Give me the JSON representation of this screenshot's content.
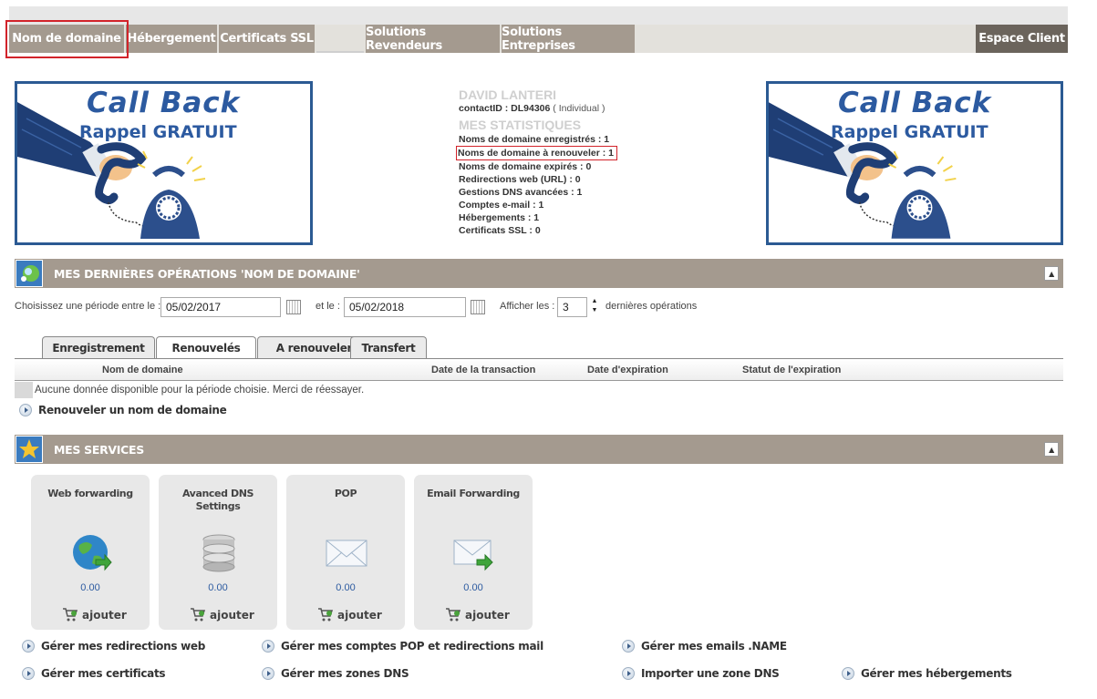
{
  "nav": {
    "tabs": [
      "Nom de domaine",
      "Hébergement",
      "Certificats SSL",
      "",
      "Solutions Revendeurs",
      "Solutions Entreprises"
    ],
    "client": "Espace Client"
  },
  "banner": {
    "title": "Call Back",
    "subtitle": "Rappel GRATUIT"
  },
  "account": {
    "name": "DAVID LANTERI",
    "contact_label": "contactID : DL94306",
    "contact_type": "( Individual )",
    "stats_heading": "MES STATISTIQUES",
    "stats": [
      "Noms de domaine enregistrés : 1",
      "Noms de domaine à renouveler : 1",
      "Noms de domaine expirés : 0",
      "Redirections web (URL) : 0",
      "Gestions DNS avancées : 1",
      "Comptes e-mail : 1",
      "Hébergements : 1",
      "Certificats SSL : 0"
    ]
  },
  "operations": {
    "title": "MES DERNIÈRES OPÉRATIONS 'NOM DE DOMAINE'",
    "filter": {
      "from_label": "Choisissez une période entre le :",
      "from_value": "05/02/2017",
      "to_label": "et le :",
      "to_value": "05/02/2018",
      "show_label": "Afficher les :",
      "count": "3",
      "suffix": "dernières opérations"
    },
    "tabs": [
      "Enregistrement",
      "Renouvelés",
      "A renouveler",
      "Transfert"
    ],
    "active_tab": "Renouvelés",
    "columns": [
      "Nom de domaine",
      "Date de la transaction",
      "Date d'expiration",
      "Statut de l'expiration"
    ],
    "empty_message": "Aucune donnée disponible pour la période choisie. Merci de réessayer.",
    "renew_link": "Renouveler un nom de domaine"
  },
  "services": {
    "title": "MES SERVICES",
    "cards": [
      {
        "title": "Web forwarding",
        "price": "0.00",
        "add": "ajouter",
        "icon": "globe-icon"
      },
      {
        "title": "Avanced DNS Settings",
        "price": "0.00",
        "add": "ajouter",
        "icon": "database-icon"
      },
      {
        "title": "POP",
        "price": "0.00",
        "add": "ajouter",
        "icon": "envelope-icon"
      },
      {
        "title": "Email Forwarding",
        "price": "0.00",
        "add": "ajouter",
        "icon": "email-forward-icon"
      }
    ],
    "links": [
      "Gérer mes redirections web",
      "Gérer mes comptes POP et redirections mail",
      "Gérer mes emails .NAME",
      "Gérer mes certificats",
      "Gérer mes zones DNS",
      "Importer une zone DNS",
      "Gérer mes hébergements"
    ]
  },
  "colors": {
    "nav": "#a49a8f",
    "client": "#6b645c",
    "accent_red": "#d2232a",
    "banner_blue": "#2c5aa0"
  }
}
